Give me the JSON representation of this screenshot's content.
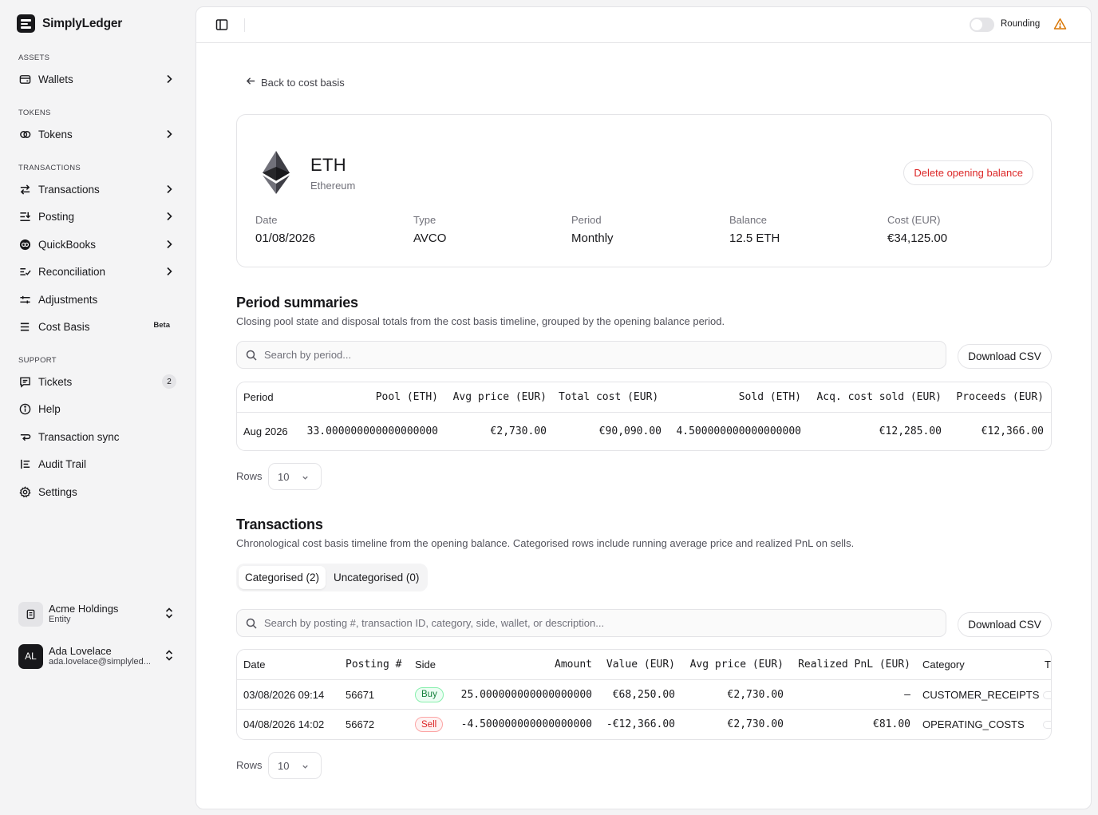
{
  "brand": {
    "name": "SimplyLedger"
  },
  "sidebar": {
    "sections": [
      {
        "label": "ASSETS"
      },
      {
        "label": "TOKENS"
      },
      {
        "label": "TRANSACTIONS"
      },
      {
        "label": "SUPPORT"
      }
    ],
    "items": [
      {
        "label": "Wallets",
        "icon": "wallet-icon"
      },
      {
        "label": "Tokens",
        "icon": "tokens-icon"
      },
      {
        "label": "Transactions",
        "icon": "arrows-exchange-icon"
      },
      {
        "label": "Posting",
        "icon": "posting-icon"
      },
      {
        "label": "QuickBooks",
        "icon": "quickbooks-icon"
      },
      {
        "label": "Reconciliation",
        "icon": "reconcile-icon"
      },
      {
        "label": "Adjustments",
        "icon": "sliders-icon"
      },
      {
        "label": "Cost Basis",
        "icon": "list-icon",
        "badge": "Beta"
      },
      {
        "label": "Tickets",
        "icon": "message-icon",
        "count": "2"
      },
      {
        "label": "Help",
        "icon": "help-icon"
      },
      {
        "label": "Transaction sync",
        "icon": "sync-icon"
      },
      {
        "label": "Audit Trail",
        "icon": "audit-icon"
      },
      {
        "label": "Settings",
        "icon": "gear-icon"
      }
    ],
    "org": {
      "name": "Acme Holdings",
      "sub": "Entity"
    },
    "user": {
      "initials": "AL",
      "name": "Ada Lovelace",
      "email": "ada.lovelace@simplyled..."
    }
  },
  "topbar": {
    "rounding_label": "Rounding",
    "rounding_on": false
  },
  "back_link": "Back to cost basis",
  "asset": {
    "symbol": "ETH",
    "name": "Ethereum",
    "delete_label": "Delete opening balance",
    "meta": [
      {
        "label": "Date",
        "value": "01/08/2026"
      },
      {
        "label": "Type",
        "value": "AVCO"
      },
      {
        "label": "Period",
        "value": "Monthly"
      },
      {
        "label": "Balance",
        "value": "12.5 ETH"
      },
      {
        "label": "Cost (EUR)",
        "value": "€34,125.00"
      }
    ]
  },
  "period_summaries": {
    "title": "Period summaries",
    "description": "Closing pool state and disposal totals from the cost basis timeline, grouped by the opening balance period.",
    "search_placeholder": "Search by period...",
    "download_label": "Download CSV",
    "columns": [
      "Period",
      "Pool (ETH)",
      "Avg price (EUR)",
      "Total cost (EUR)",
      "Sold (ETH)",
      "Acq. cost sold (EUR)",
      "Proceeds (EUR)"
    ],
    "rows": [
      [
        "Aug 2026",
        "33.000000000000000000",
        "€2,730.00",
        "€90,090.00",
        "4.500000000000000000",
        "€12,285.00",
        "€12,366.00"
      ]
    ],
    "rows_label": "Rows",
    "rows_value": "10"
  },
  "transactions": {
    "title": "Transactions",
    "description": "Chronological cost basis timeline from the opening balance. Categorised rows include running average price and realized PnL on sells.",
    "tabs": [
      {
        "label": "Categorised (2)",
        "active": true
      },
      {
        "label": "Uncategorised (0)",
        "active": false
      }
    ],
    "search_placeholder": "Search by posting #, transaction ID, category, side, wallet, or description...",
    "download_label": "Download CSV",
    "columns": [
      "Date",
      "Posting #",
      "Side",
      "Amount",
      "Value (EUR)",
      "Avg price (EUR)",
      "Realized PnL (EUR)",
      "Category",
      "Tr"
    ],
    "rows": [
      [
        "03/08/2026 09:14",
        "56671",
        "Buy",
        "25.000000000000000000",
        "€68,250.00",
        "€2,730.00",
        "–",
        "CUSTOMER_RECEIPTS"
      ],
      [
        "04/08/2026 14:02",
        "56672",
        "Sell",
        "-4.500000000000000000",
        "-€12,366.00",
        "€2,730.00",
        "€81.00",
        "OPERATING_COSTS"
      ]
    ],
    "rows_label": "Rows",
    "rows_value": "10"
  },
  "colors": {
    "danger": "#dc2626",
    "buy": "#15803d",
    "text": "#18181b",
    "muted": "#71717a"
  }
}
